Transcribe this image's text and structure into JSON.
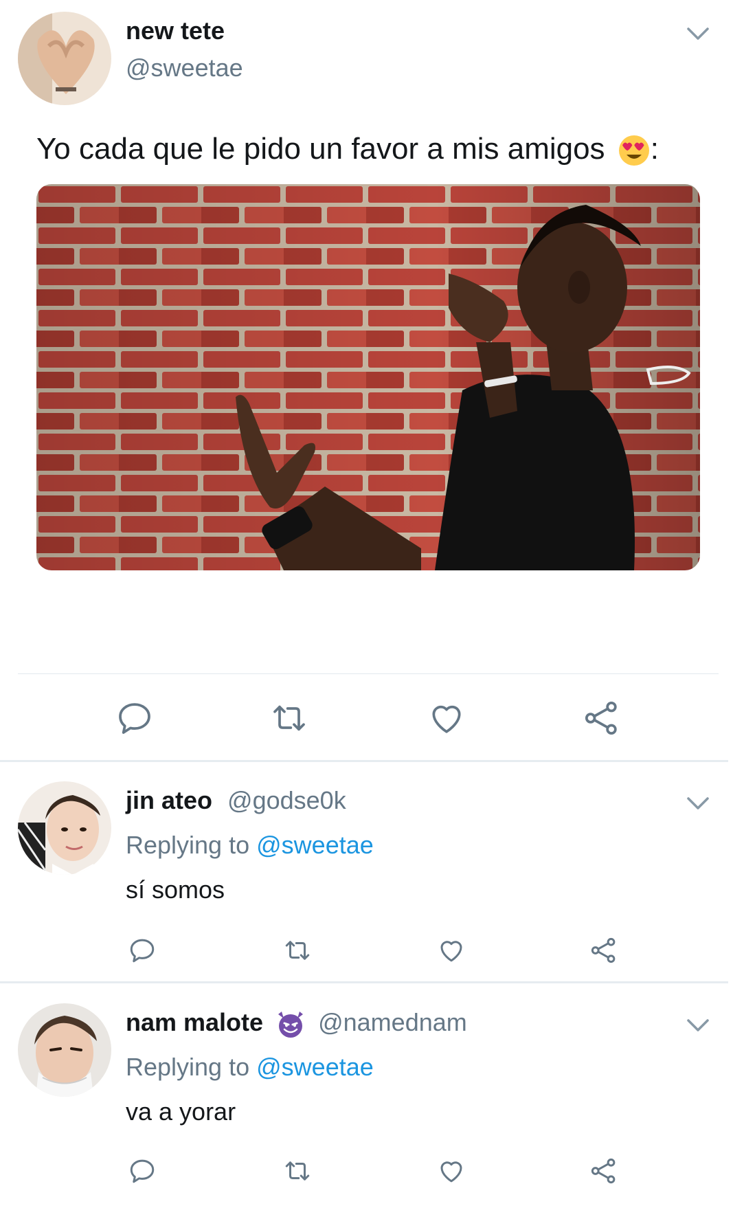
{
  "tweet": {
    "author_name": "new tete",
    "author_handle": "@sweetae",
    "text": "Yo cada que le pido un favor a mis amigos",
    "text_suffix": ":",
    "text_emoji": "smiling-face-with-heart-eyes",
    "media_description_icon": "man-talking-to-brick-wall-photo"
  },
  "actions": {
    "reply_icon": "reply-icon",
    "retweet_icon": "retweet-icon",
    "like_icon": "heart-icon",
    "share_icon": "share-icon"
  },
  "replies": [
    {
      "author_name": "jin ateo",
      "author_handle": "@godse0k",
      "replying_prefix": "Replying to",
      "replying_to": "@sweetae",
      "text": "sí somos"
    },
    {
      "author_name": "nam malote",
      "author_emoji": "smiling-devil",
      "author_handle": "@namednam",
      "replying_prefix": "Replying to",
      "replying_to": "@sweetae",
      "text": "va a yorar"
    }
  ],
  "colors": {
    "text": "#14171a",
    "secondary": "#657786",
    "link": "#1b95e0",
    "divider": "#e6ecf0",
    "icon": "#657786"
  }
}
